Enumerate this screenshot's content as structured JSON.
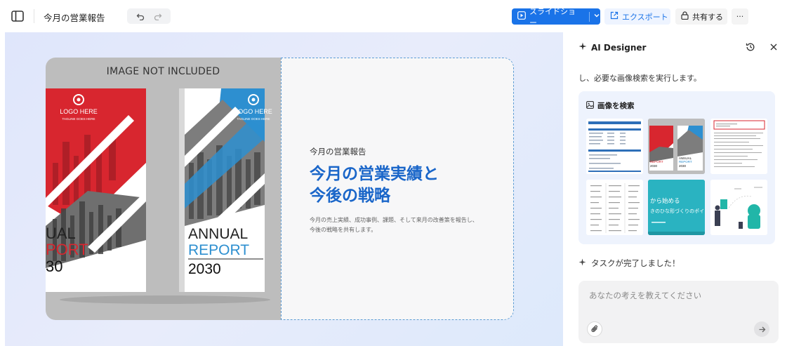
{
  "topbar": {
    "doc_title": "今月の営業報告",
    "slideshow_label": "スライドショー",
    "export_label": "エクスポート",
    "share_label": "共有する",
    "more_label": "···"
  },
  "slide": {
    "image_banner": "IMAGE NOT INCLUDED",
    "cover_logo": "LOGO HERE",
    "cover_tagline": "TAGLINE GOES HERE",
    "cover_annual": "ANNUAL",
    "cover_report": "REPORT",
    "cover_year": "2030",
    "left_cover_annual": "UAL",
    "left_cover_report": "PORT",
    "left_cover_year": "30",
    "subtitle": "今月の営業報告",
    "title_line1": "今月の営業実績と",
    "title_line2": "今後の戦略",
    "body_line1": "今月の売上実績、成功事例、課題、そして来月の改善策を報告し、",
    "body_line2": "今後の戦略を共有します。"
  },
  "panel": {
    "header": "AI Designer",
    "message": "し、必要な画像検索を実行します。",
    "search_card_title": "画像を検索",
    "thumb5_line1": "から始める",
    "thumb5_line2": "きのひな形づくりのポイ",
    "done_label": "タスクが完了しました！",
    "chat_placeholder": "あなたの考えを教えてください"
  },
  "colors": {
    "accent": "#1a73e8",
    "slide_title": "#1a66c9",
    "cover_red": "#d8262f",
    "cover_blue": "#2d8fd0"
  }
}
